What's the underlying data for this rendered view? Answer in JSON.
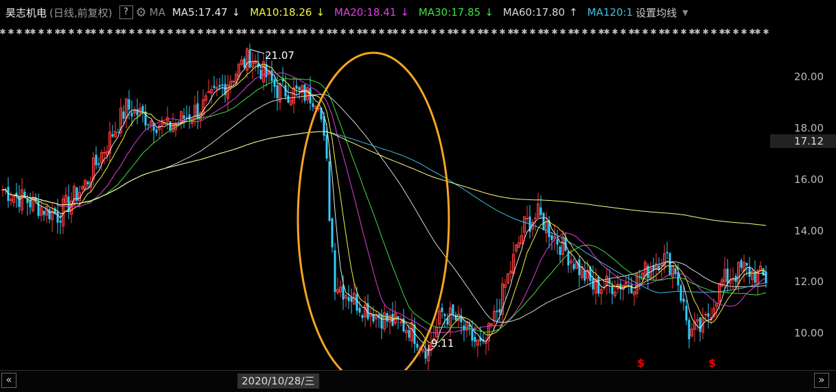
{
  "header": {
    "stock_name": "昊志机电",
    "period": "(日线,前复权)",
    "help": "?",
    "ma_label": "MA",
    "ma_items": [
      {
        "text": "MA5:17.47",
        "arrow": "↓",
        "color": "#e8e8e8"
      },
      {
        "text": "MA10:18.26",
        "arrow": "↓",
        "color": "#f5f542"
      },
      {
        "text": "MA20:18.41",
        "arrow": "↓",
        "color": "#e040e0"
      },
      {
        "text": "MA30:17.85",
        "arrow": "↓",
        "color": "#40e040"
      },
      {
        "text": "MA60:17.80",
        "arrow": "↑",
        "color": "#d8d8d8"
      },
      {
        "text": "MA120:1",
        "arrow": "",
        "color": "#40c0e0"
      }
    ],
    "settings": "设置均线"
  },
  "price_axis": {
    "ticks": [
      "20.00",
      "18.00",
      "16.00",
      "14.00",
      "12.00",
      "10.00"
    ],
    "current_price": "17.12"
  },
  "annotations": {
    "high": "21.07",
    "low": "9.11"
  },
  "signals": [
    "$",
    "$"
  ],
  "bottom": {
    "date": "2020/10/28/三",
    "prev": "«",
    "next": "»"
  },
  "colors": {
    "up": "#ff3b3b",
    "down": "#30d0ff",
    "ellipse": "#f5a623",
    "ma5": "#e8e8e8",
    "ma10": "#f5f542",
    "ma20": "#e040e0",
    "ma30": "#40e040",
    "ma60": "#d8d8d8",
    "ma120": "#40c0e0",
    "ma250": "#ffff88"
  },
  "chart_data": {
    "type": "candlestick",
    "ylim": [
      9.0,
      21.5
    ],
    "close_key_points": [
      {
        "i": 0,
        "close": 15.6
      },
      {
        "i": 20,
        "close": 14.6
      },
      {
        "i": 30,
        "close": 15.8
      },
      {
        "i": 45,
        "close": 18.8
      },
      {
        "i": 60,
        "close": 18.0
      },
      {
        "i": 75,
        "close": 19.0
      },
      {
        "i": 90,
        "close": 20.8
      },
      {
        "i": 100,
        "close": 19.5
      },
      {
        "i": 115,
        "close": 19.2
      },
      {
        "i": 118,
        "close": 16.5
      },
      {
        "i": 119,
        "close": 14.7
      },
      {
        "i": 121,
        "close": 12.0
      },
      {
        "i": 130,
        "close": 11.1
      },
      {
        "i": 140,
        "close": 10.5
      },
      {
        "i": 148,
        "close": 10.2
      },
      {
        "i": 155,
        "close": 9.3
      },
      {
        "i": 160,
        "close": 10.8
      },
      {
        "i": 165,
        "close": 10.5
      },
      {
        "i": 175,
        "close": 9.3
      },
      {
        "i": 182,
        "close": 11.5
      },
      {
        "i": 190,
        "close": 14.2
      },
      {
        "i": 195,
        "close": 14.6
      },
      {
        "i": 205,
        "close": 13.2
      },
      {
        "i": 215,
        "close": 11.8
      },
      {
        "i": 230,
        "close": 12.0
      },
      {
        "i": 240,
        "close": 13.0
      },
      {
        "i": 245,
        "close": 12.5
      },
      {
        "i": 250,
        "close": 10.0
      },
      {
        "i": 255,
        "close": 10.2
      },
      {
        "i": 262,
        "close": 12.0
      },
      {
        "i": 270,
        "close": 12.5
      },
      {
        "i": 278,
        "close": 12.1
      }
    ],
    "high": 21.07,
    "low": 9.11,
    "last": 12.1
  }
}
